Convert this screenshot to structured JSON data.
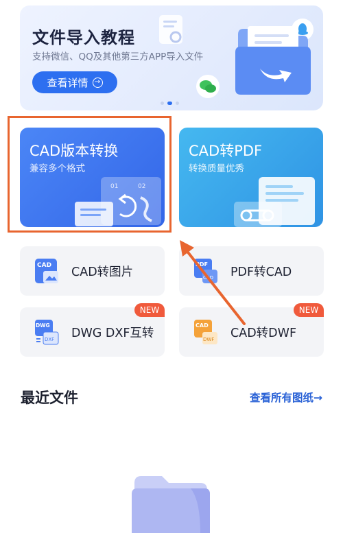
{
  "banner": {
    "title": "文件导入教程",
    "subtitle": "支持微信、QQ及其他第三方APP导入文件",
    "button_label": "查看详情",
    "button_arrow": "→",
    "page_count": 3,
    "active_page": 2
  },
  "cards": {
    "cad_convert": {
      "title": "CAD版本转换",
      "subtitle": "兼容多个格式"
    },
    "cad_to_pdf": {
      "title": "CAD转PDF",
      "subtitle": "转换质量优秀"
    }
  },
  "tools": [
    {
      "label": "CAD转图片",
      "icon": "cad-image-icon",
      "icon_text": "CAD",
      "badge": ""
    },
    {
      "label": "PDF转CAD",
      "icon": "pdf-cad-icon",
      "icon_text": "PDF",
      "icon_text2": "CAD",
      "badge": ""
    },
    {
      "label": "DWG DXF互转",
      "icon": "dwg-dxf-icon",
      "icon_text": "DWG",
      "icon_text2": "DXF",
      "badge": "NEW"
    },
    {
      "label": "CAD转DWF",
      "icon": "cad-dwf-icon",
      "icon_text": "CAD",
      "icon_text2": "DWF",
      "badge": "NEW"
    }
  ],
  "recent": {
    "title": "最近文件",
    "view_all": "查看所有图纸→"
  },
  "colors": {
    "primary": "#2d6ff0",
    "highlight": "#e8652f",
    "badge": "#f05a3c"
  }
}
